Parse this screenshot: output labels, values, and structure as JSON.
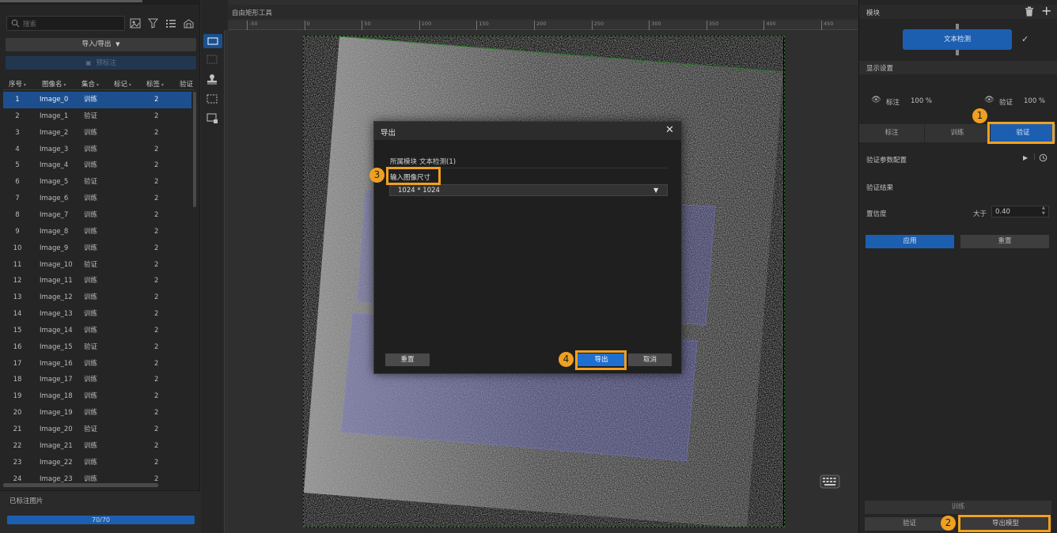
{
  "left": {
    "search_placeholder": "搜索",
    "import_export_label": "导入/导出",
    "pre_annotate_label": "预标注",
    "columns": [
      "序号",
      "图像名",
      "集合",
      "标记",
      "标签",
      "验证"
    ],
    "rows": [
      {
        "no": "1",
        "name": "Image_0",
        "set": "训练",
        "tag": "2"
      },
      {
        "no": "2",
        "name": "Image_1",
        "set": "验证",
        "tag": "2"
      },
      {
        "no": "3",
        "name": "Image_2",
        "set": "训练",
        "tag": "2"
      },
      {
        "no": "4",
        "name": "Image_3",
        "set": "训练",
        "tag": "2"
      },
      {
        "no": "5",
        "name": "Image_4",
        "set": "训练",
        "tag": "2"
      },
      {
        "no": "6",
        "name": "Image_5",
        "set": "验证",
        "tag": "2"
      },
      {
        "no": "7",
        "name": "Image_6",
        "set": "训练",
        "tag": "2"
      },
      {
        "no": "8",
        "name": "Image_7",
        "set": "训练",
        "tag": "2"
      },
      {
        "no": "9",
        "name": "Image_8",
        "set": "训练",
        "tag": "2"
      },
      {
        "no": "10",
        "name": "Image_9",
        "set": "训练",
        "tag": "2"
      },
      {
        "no": "11",
        "name": "Image_10",
        "set": "验证",
        "tag": "2"
      },
      {
        "no": "12",
        "name": "Image_11",
        "set": "训练",
        "tag": "2"
      },
      {
        "no": "13",
        "name": "Image_12",
        "set": "训练",
        "tag": "2"
      },
      {
        "no": "14",
        "name": "Image_13",
        "set": "训练",
        "tag": "2"
      },
      {
        "no": "15",
        "name": "Image_14",
        "set": "训练",
        "tag": "2"
      },
      {
        "no": "16",
        "name": "Image_15",
        "set": "验证",
        "tag": "2"
      },
      {
        "no": "17",
        "name": "Image_16",
        "set": "训练",
        "tag": "2"
      },
      {
        "no": "18",
        "name": "Image_17",
        "set": "训练",
        "tag": "2"
      },
      {
        "no": "19",
        "name": "Image_18",
        "set": "训练",
        "tag": "2"
      },
      {
        "no": "20",
        "name": "Image_19",
        "set": "训练",
        "tag": "2"
      },
      {
        "no": "21",
        "name": "Image_20",
        "set": "验证",
        "tag": "2"
      },
      {
        "no": "22",
        "name": "Image_21",
        "set": "训练",
        "tag": "2"
      },
      {
        "no": "23",
        "name": "Image_22",
        "set": "训练",
        "tag": "2"
      },
      {
        "no": "24",
        "name": "Image_23",
        "set": "训练",
        "tag": "2"
      }
    ],
    "labeled_title": "已标注图片",
    "progress_text": "70/70",
    "progress_fraction": 1.0
  },
  "canvas": {
    "tool_title": "自由矩形工具",
    "ruler_ticks": [
      "-50",
      "0",
      "50",
      "100",
      "150",
      "200",
      "250",
      "300",
      "350",
      "400",
      "450"
    ]
  },
  "dialog": {
    "title": "导出",
    "module_label": "所属模块",
    "module_value": "文本检测(1)",
    "size_label": "输入图像尺寸",
    "size_value": "1024 * 1024",
    "reset_label": "重置",
    "export_label": "导出",
    "cancel_label": "取消"
  },
  "right": {
    "title": "模块",
    "module_node_label": "文本检测",
    "display_settings": "显示设置",
    "annotate_label": "标注",
    "annotate_pct": "100 %",
    "verify_label": "验证",
    "verify_pct": "100 %",
    "tabs": [
      "标注",
      "训练",
      "验证"
    ],
    "param_config": "验证参数配置",
    "result_title": "验证结果",
    "confidence_label": "置信度",
    "greater_label": "大于",
    "confidence_value": "0.40",
    "apply_label": "应用",
    "reset_label": "重置",
    "train_label": "训练",
    "verify_btn_label": "验证",
    "export_model_label": "导出模型"
  },
  "annotations": [
    "1",
    "2",
    "3",
    "4"
  ],
  "colors": {
    "accent": "#1c5fb0",
    "highlight": "#f0a020",
    "selected_row": "#1d4f8f"
  }
}
